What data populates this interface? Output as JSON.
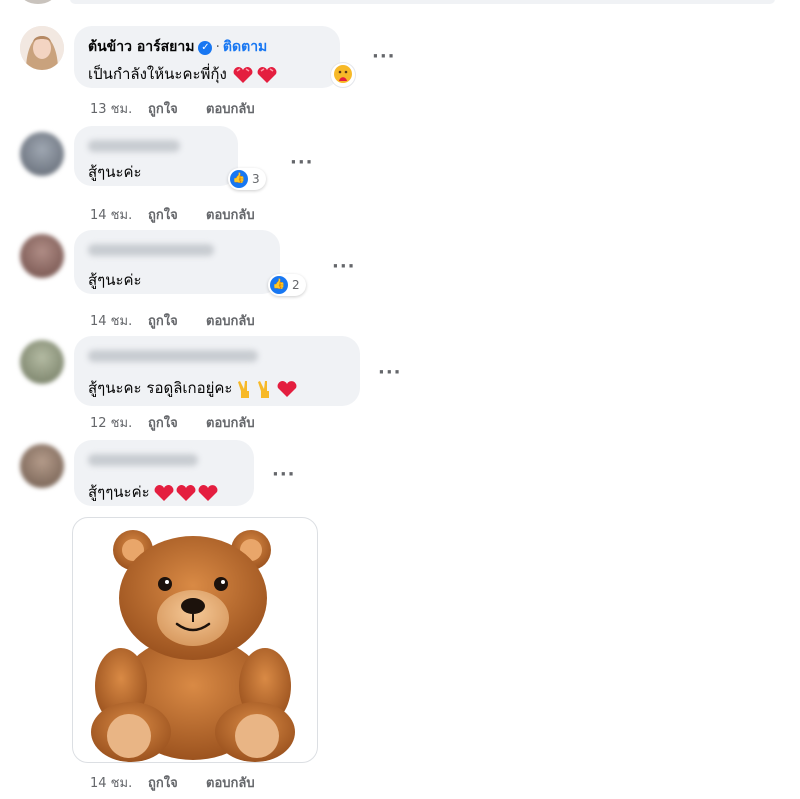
{
  "comments": [
    {
      "author": "ต้นข้าว อาร์สยาม",
      "verified": true,
      "separator": "·",
      "follow_label": "ติดตาม",
      "text": "เป็นกำลังให้นะคะพี่กุ้ง",
      "time": "13 ชม.",
      "like_label": "ถูกใจ",
      "reply_label": "ตอบกลับ",
      "more": "···"
    },
    {
      "text": "สู้ๆนะค่ะ",
      "reaction_count": "3",
      "time": "14 ชม.",
      "like_label": "ถูกใจ",
      "reply_label": "ตอบกลับ",
      "more": "···"
    },
    {
      "text": "สู้ๆนะค่ะ",
      "reaction_count": "2",
      "time": "14 ชม.",
      "like_label": "ถูกใจ",
      "reply_label": "ตอบกลับ",
      "more": "···"
    },
    {
      "text": "สู้ๆนะคะ รอดูลิเกอยู่คะ",
      "time": "12 ชม.",
      "like_label": "ถูกใจ",
      "reply_label": "ตอบกลับ",
      "more": "···"
    },
    {
      "text": "สู้ๆๆนะค่ะ",
      "time": "14 ชม.",
      "like_label": "ถูกใจ",
      "reply_label": "ตอบกลับ",
      "more": "···"
    }
  ],
  "colors": {
    "bubble": "#f0f2f5",
    "accent": "#1877f2",
    "meta": "#65676b",
    "heart": "#e41e3f"
  },
  "icons": [
    "verified-badge-icon",
    "like-reaction-icon",
    "heart-emoji-icon",
    "victory-hand-icon",
    "teddy-bear-sticker"
  ]
}
